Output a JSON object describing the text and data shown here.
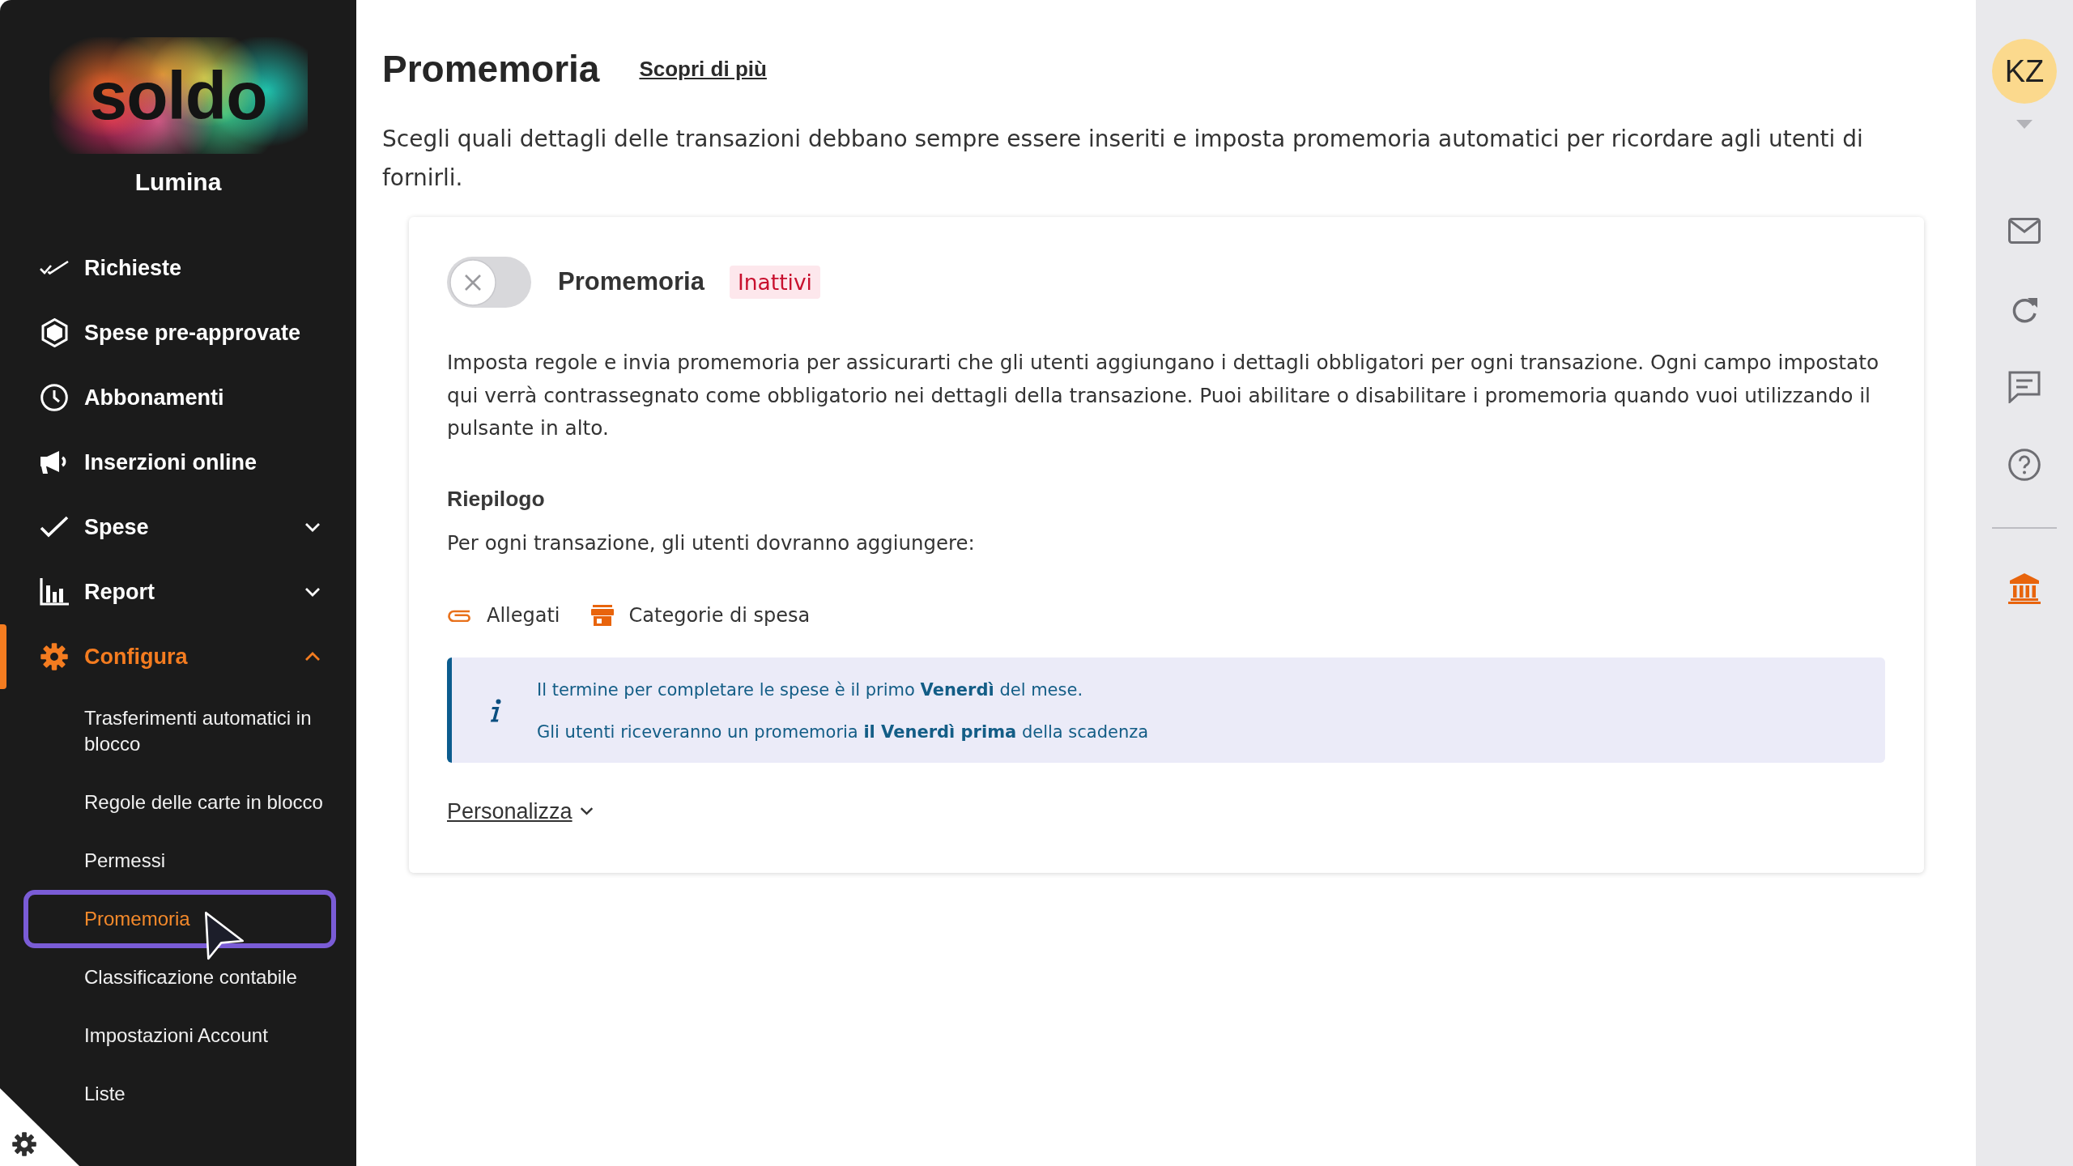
{
  "sidebar": {
    "logo": "soldo",
    "organization": "Lumina",
    "nav_items": [
      {
        "label": "Richieste",
        "selected": false
      },
      {
        "label": "Spese pre-approvate",
        "selected": false
      },
      {
        "label": "Abbonamenti",
        "selected": false
      },
      {
        "label": "Inserzioni online",
        "selected": false
      },
      {
        "label": "Spese",
        "selected": false,
        "expanded": false
      },
      {
        "label": "Report",
        "selected": false,
        "expanded": false
      },
      {
        "label": "Configura",
        "selected": true,
        "expanded": true,
        "children": [
          {
            "label": "Trasferimenti automatici in blocco",
            "selected": false
          },
          {
            "label": "Regole delle carte in blocco",
            "selected": false
          },
          {
            "label": "Permessi",
            "selected": false
          },
          {
            "label": "Promemoria",
            "selected": true
          },
          {
            "label": "Classificazione contabile",
            "selected": false
          },
          {
            "label": "Impostazioni Account",
            "selected": false
          },
          {
            "label": "Liste",
            "selected": false
          }
        ]
      }
    ]
  },
  "header": {
    "title": "Promemoria",
    "link": "Scopri di più",
    "description": "Scegli quali dettagli delle transazioni debbano sempre essere inseriti e imposta promemoria automatici per ricordare agli utenti di fornirli."
  },
  "reminder_card": {
    "toggle": {
      "on": false
    },
    "title": "Promemoria",
    "status": "Inattivi",
    "description": "Imposta regole e invia promemoria per assicurarti che gli utenti aggiungano i dettagli obbligatori per ogni transazione. Ogni campo impostato qui verrà contrassegnato come obbligatorio nei dettagli della transazione. Puoi abilitare o disabilitare i promemoria quando vuoi utilizzando il pulsante in alto.",
    "summary": {
      "title": "Riepilogo",
      "intro": "Per ogni transazione, gli utenti dovranno aggiungere:",
      "fields": [
        {
          "label": "Allegati"
        },
        {
          "label": "Categorie di spesa"
        }
      ]
    },
    "info": {
      "lines": [
        "Il termine per completare le spese è il primo **Venerdì** del mese.",
        "Gli utenti riceveranno un promemoria **il Venerdì prima** della scadenza"
      ]
    },
    "customize": {
      "label": "Personalizza",
      "expanded": false
    }
  },
  "user_rail": {
    "avatar": "KZ"
  }
}
